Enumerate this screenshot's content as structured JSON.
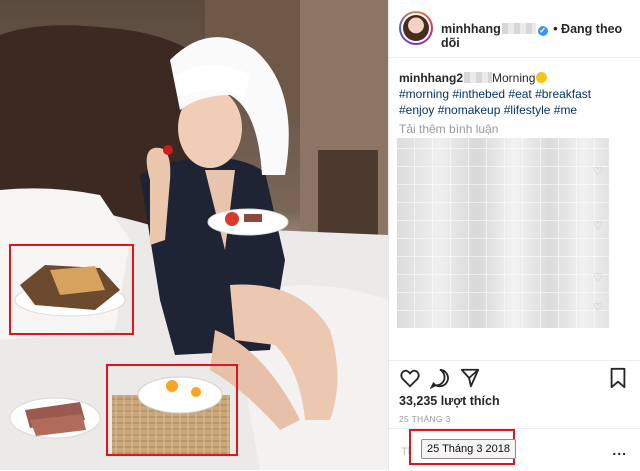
{
  "post": {
    "username": "minhhang",
    "follow_status": "• Đang theo dõi",
    "caption_user": "minhhang2",
    "caption_text": "Morning",
    "hashtags_line1": "#morning #inthebed #eat #breakfast",
    "hashtags_line2": "#enjoy #nomakeup #lifestyle #me",
    "load_more": "Tải thêm bình luận",
    "likes": "33,235 lượt thích",
    "date_small": "25 THÁNG 3",
    "date_tooltip": "25 Tháng 3 2018",
    "comment_hint": "Thêm",
    "more_label": "..."
  },
  "icons": {
    "verified": "verified-badge-icon",
    "heart": "heart-icon",
    "comment": "comment-icon",
    "share": "share-icon",
    "bookmark": "bookmark-icon",
    "more": "more-options-icon"
  },
  "colors": {
    "highlight": "#e3131b",
    "hashtag": "#003569",
    "verified": "#3897f0"
  }
}
